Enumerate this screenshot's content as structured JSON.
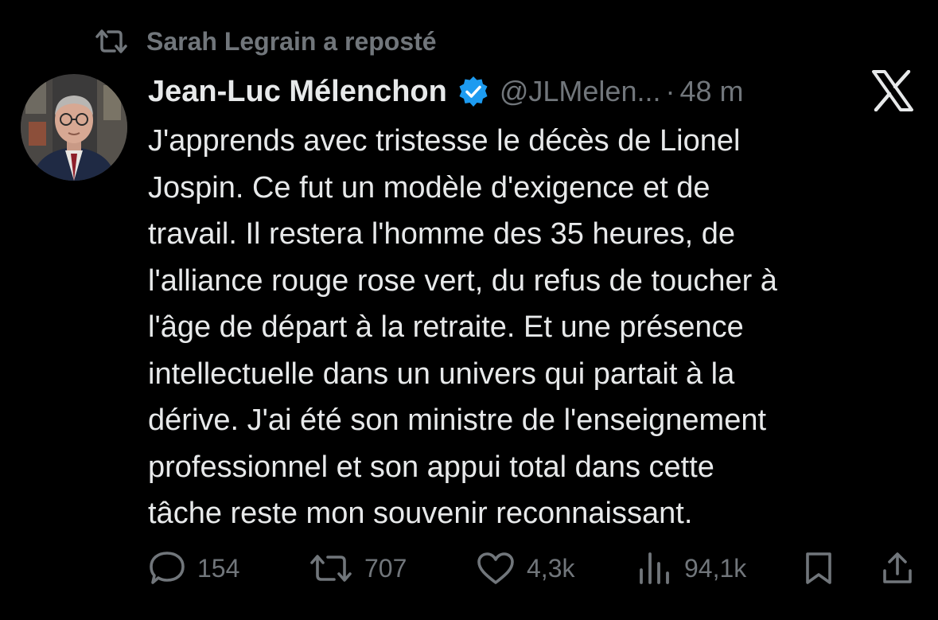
{
  "repost": {
    "icon": "repost-icon",
    "text": "Sarah Legrain a reposté"
  },
  "author": {
    "avatar": "avatar",
    "name": "Jean-Luc Mélenchon",
    "verified_icon": "verified-badge-icon",
    "handle": "@JLMelen...",
    "separator": "·",
    "time": "48 m"
  },
  "brand": {
    "logo": "x-logo-icon"
  },
  "tweet": {
    "text": "J'apprends avec tristesse le décès de Lionel\nJospin. Ce fut un modèle d'exigence et de\ntravail. Il restera l'homme des 35 heures, de\nl'alliance rouge rose vert, du refus de toucher à\nl'âge de départ à la retraite. Et une présence\nintellectuelle dans un univers qui partait à la\ndérive. J'ai été son ministre de l'enseignement\nprofessionnel et son appui total dans cette\ntâche reste mon souvenir reconnaissant."
  },
  "actions": {
    "replies": {
      "icon": "reply-icon",
      "count": "154"
    },
    "reposts": {
      "icon": "repost-icon",
      "count": "707"
    },
    "likes": {
      "icon": "heart-icon",
      "count": "4,3k"
    },
    "views": {
      "icon": "views-icon",
      "count": "94,1k"
    },
    "bookmark": {
      "icon": "bookmark-icon"
    },
    "share": {
      "icon": "share-icon"
    }
  },
  "colors": {
    "background": "#000000",
    "text": "#e7e9ea",
    "muted": "#71767b",
    "verified": "#1d9bf0"
  }
}
